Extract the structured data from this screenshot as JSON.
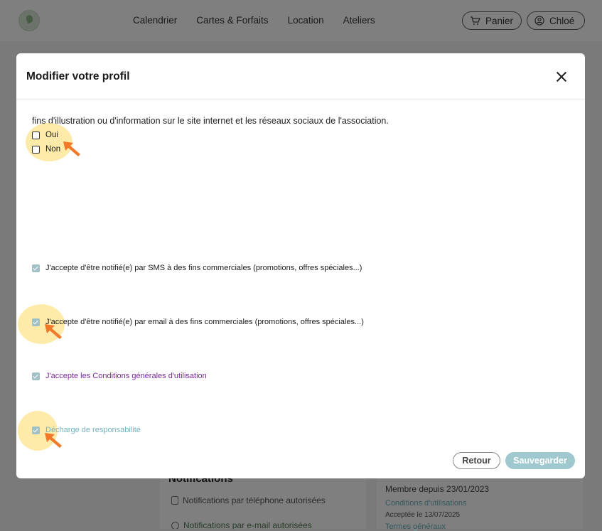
{
  "nav": {
    "links": [
      "Calendrier",
      "Cartes & Forfaits",
      "Location",
      "Ateliers"
    ],
    "cart_label": "Panier",
    "user_label": "Chloé"
  },
  "background": {
    "notifications_title": "Notifications",
    "phone_label": "Notifications par téléphone autorisées",
    "email_label": "Notifications par e-mail autorisées",
    "member_since": "Membre depuis 23/01/2023",
    "conditions_link": "Conditions d'utilisations",
    "accepted_on": "Acceptée le 13/07/2025",
    "terms_link": "Termes généraux"
  },
  "modal": {
    "title": "Modifier votre profil",
    "intro_text": "fins d'illustration ou d'information sur le site internet et les réseaux sociaux de l'association.",
    "options": {
      "oui": "Oui",
      "non": "Non"
    },
    "sms_consent": "J'accepte d'être notifié(e) par SMS à des fins commerciales (promotions, offres spéciales...)",
    "email_consent": "J'accepte d'être notifié(e) par email à des fins commerciales (promotions, offres spéciales...)",
    "cgu_consent": "J'accepte les Conditions générales d'utilisation",
    "liability_waiver": "Décharge de responsabilité",
    "back_button": "Retour",
    "save_button": "Sauvegarder"
  },
  "colors": {
    "accent_teal": "#a0c8cf",
    "highlight_yellow": "#ffe48c",
    "arrow_orange": "#f07a2a",
    "link_purple": "#7a2a9a"
  },
  "icons": [
    "cart-icon",
    "user-icon",
    "close-icon",
    "arrow-pointer-icon",
    "checkbox-icon"
  ]
}
